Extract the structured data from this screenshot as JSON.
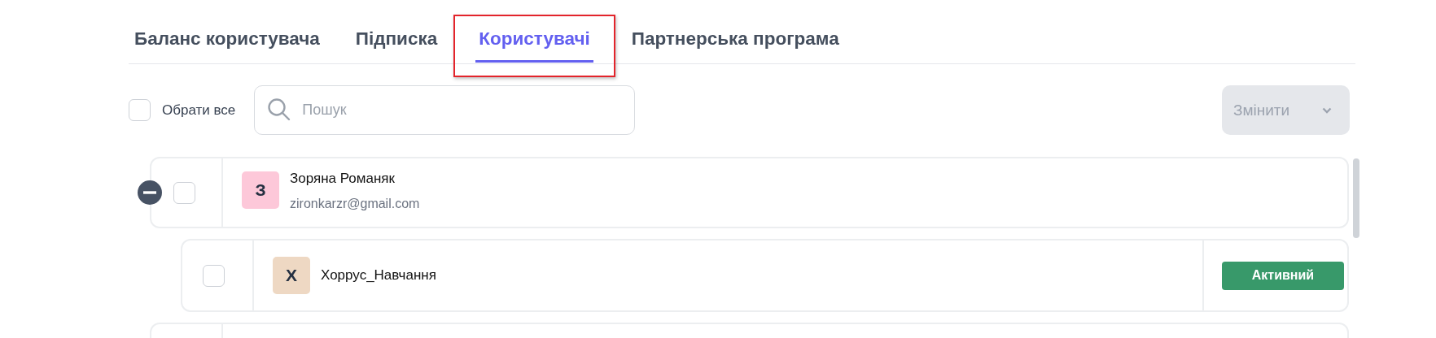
{
  "tabs": [
    {
      "label": "Баланс користувача",
      "selected": false,
      "highlighted": false
    },
    {
      "label": "Підписка",
      "selected": false,
      "highlighted": false
    },
    {
      "label": "Користувачі",
      "selected": true,
      "highlighted": true
    },
    {
      "label": "Партнерська програма",
      "selected": false,
      "highlighted": false
    }
  ],
  "select_all": {
    "label": "Обрати все",
    "checked": false
  },
  "search": {
    "placeholder": "Пошук"
  },
  "change_button": {
    "label": "Змінити",
    "disabled": true
  },
  "users": [
    {
      "initial": "З",
      "color": "#fdc8d9",
      "name": "Зоряна Романяк",
      "email": "zironkarzr@gmail.com",
      "checked": false,
      "expanded": true,
      "children": [
        {
          "initial": "Х",
          "color": "#eed8c3",
          "name": "Хоррус_Навчання",
          "checked": false,
          "status": "Активний"
        }
      ]
    }
  ]
}
